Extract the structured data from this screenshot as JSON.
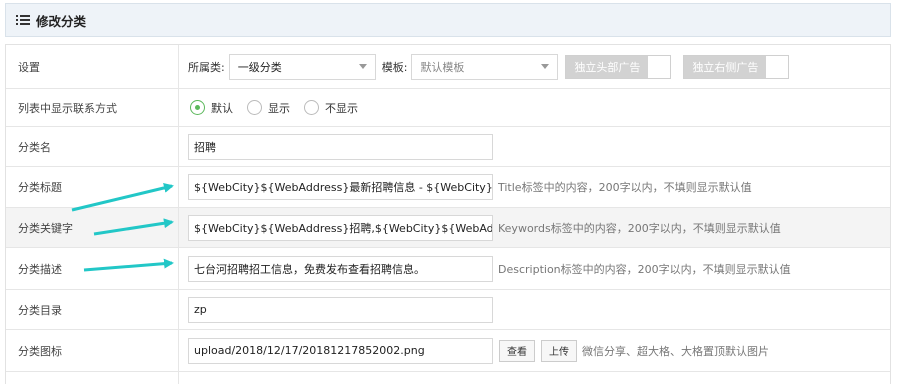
{
  "header": {
    "title": "修改分类",
    "icon": "list-icon"
  },
  "settings": {
    "label": "设置",
    "parent_label": "所属类:",
    "parent_value": "一级分类",
    "template_label": "模板:",
    "template_value": "默认模板",
    "toggle_header_ad": "独立头部广告",
    "toggle_side_ad": "独立右侧广告"
  },
  "contact": {
    "label": "列表中显示联系方式",
    "options": [
      "默认",
      "显示",
      "不显示"
    ],
    "selected": "默认"
  },
  "name": {
    "label": "分类名",
    "value": "招聘"
  },
  "seo_title": {
    "label": "分类标题",
    "value": "${WebCity}${WebAddress}最新招聘信息 - ${WebCity}${WebAddr",
    "hint": "Title标签中的内容，200字以内，不填则显示默认值"
  },
  "seo_keywords": {
    "label": "分类关键字",
    "value": "${WebCity}${WebAddress}招聘,${WebCity}${WebAddress}兼职,$",
    "hint": "Keywords标签中的内容，200字以内，不填则显示默认值"
  },
  "seo_desc": {
    "label": "分类描述",
    "value": "七台河招聘招工信息，免费发布查看招聘信息。",
    "hint": "Description标签中的内容，200字以内，不填则显示默认值"
  },
  "dir": {
    "label": "分类目录",
    "value": "zp"
  },
  "icon": {
    "label": "分类图标",
    "value": "upload/2018/12/17/20181217852002.png",
    "view_button": "查看",
    "upload_button": "上传",
    "hint": "微信分享、超大格、大格置顶默认图片"
  },
  "colors": {
    "accent": "#5cb85c",
    "arrow": "#22c7c7",
    "header_bg": "#eef3f8"
  }
}
